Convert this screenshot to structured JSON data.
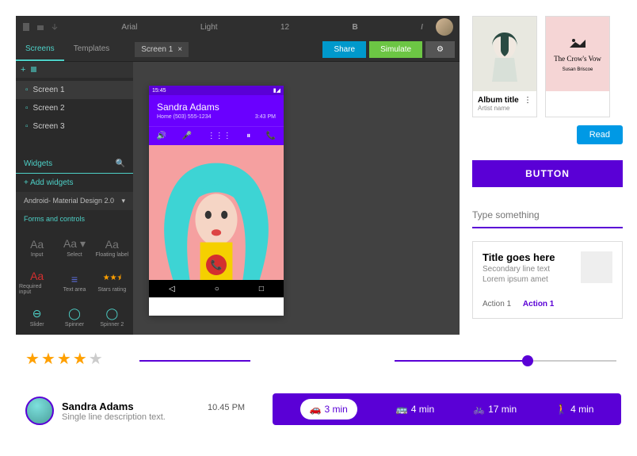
{
  "editor": {
    "font_name": "Arial",
    "font_weight": "Light",
    "font_size": "12",
    "tabs": {
      "screens": "Screens",
      "templates": "Templates"
    },
    "canvas_tab": "Screen 1",
    "share": "Share",
    "simulate": "Simulate",
    "screens": [
      "Screen 1",
      "Screen 2",
      "Screen 3"
    ],
    "widgets_label": "Widgets",
    "add_widgets": "+ Add widgets",
    "category": "Android- Material Design 2.0",
    "subcat": "Forms and controls",
    "widgets": [
      {
        "icon": "Aa",
        "label": "Input"
      },
      {
        "icon": "Aa ▾",
        "label": "Select"
      },
      {
        "icon": "Aa",
        "label": "Floating label"
      },
      {
        "icon": "Aa",
        "label": "Required input"
      },
      {
        "icon": "≡",
        "label": "Text area"
      },
      {
        "icon": "★★⯨",
        "label": "Stars rating"
      },
      {
        "icon": "⊖",
        "label": "Slider"
      },
      {
        "icon": "◯",
        "label": "Spinner"
      },
      {
        "icon": "◯",
        "label": "Spinner 2"
      }
    ]
  },
  "phone": {
    "time": "15:45",
    "caller": "Sandra Adams",
    "number": "Home (503) 555-1234",
    "duration": "3:43 PM"
  },
  "album": {
    "title": "Album title",
    "artist": "Artist name"
  },
  "book": {
    "title": "The Crow's Vow",
    "author": "Susan Briscoe"
  },
  "read": "Read",
  "button": "BUTTON",
  "input_placeholder": "Type something",
  "tile": {
    "title": "Title goes here",
    "sub1": "Secondary line text",
    "sub2": "Lorem ipsum amet",
    "a1": "Action 1",
    "a2": "Action 1"
  },
  "user": {
    "name": "Sandra Adams",
    "sub": "Single line description text.",
    "time": "10.45 PM"
  },
  "transit": [
    {
      "icon": "🚗",
      "time": "3 min"
    },
    {
      "icon": "🚌",
      "time": "4 min"
    },
    {
      "icon": "🚲",
      "time": "17 min"
    },
    {
      "icon": "🚶",
      "time": "4 min"
    }
  ]
}
